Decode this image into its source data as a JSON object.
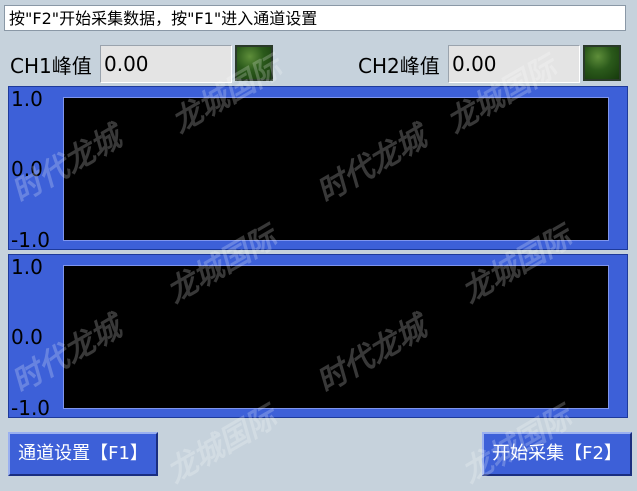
{
  "status_bar": {
    "text": "按\"F2\"开始采集数据，按\"F1\"进入通道设置"
  },
  "channels": [
    {
      "label": "CH1峰值",
      "value": "0.00"
    },
    {
      "label": "CH2峰值",
      "value": "0.00"
    }
  ],
  "charts": [
    {
      "y_ticks": [
        "1.0",
        "0.0",
        "-1.0"
      ]
    },
    {
      "y_ticks": [
        "1.0",
        "0.0",
        "-1.0"
      ]
    }
  ],
  "buttons": {
    "channel_settings": "通道设置【F1】",
    "start_capture": "开始采集【F2】"
  },
  "watermarks": [
    "时代龙城",
    "龙城国际"
  ],
  "colors": {
    "panel": "#3d60d8",
    "plot_bg": "#000000",
    "led": "#2b5a1b"
  }
}
